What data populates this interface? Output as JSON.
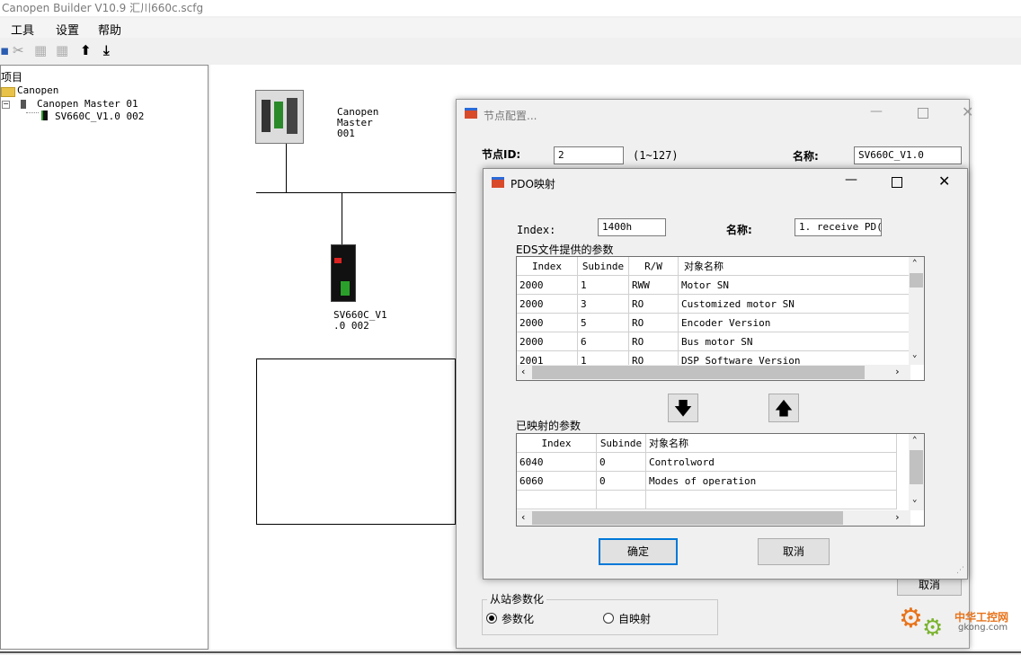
{
  "app": {
    "title": "Canopen Builder V10.9  汇川660c.scfg"
  },
  "menu": {
    "tools": "工具",
    "settings": "设置",
    "help": "帮助"
  },
  "tree": {
    "root": "项目",
    "canopen": "Canopen",
    "master": "Canopen Master  01",
    "slave": "SV660C_V1.0 002"
  },
  "canvas": {
    "master_label_1": "Canopen",
    "master_label_2": "Master",
    "master_label_3": "001",
    "slave_label_1": "SV660C_V1",
    "slave_label_2": ".0   002"
  },
  "node_dialog": {
    "title": "节点配置...",
    "node_id_label": "节点ID:",
    "node_id_value": "2",
    "node_id_range": "(1~127)",
    "name_label": "名称:",
    "name_value": "SV660C_V1.0",
    "cancel_label": "取消",
    "slave_param_group": "从站参数化",
    "radio_param": "参数化",
    "radio_automap": "自映射"
  },
  "pdo_dialog": {
    "title": "PDO映射",
    "index_label": "Index:",
    "index_value": "1400h",
    "name_label": "名称:",
    "name_value": "1. receive PD(",
    "eds_label": "EDS文件提供的参数",
    "eds_headers": [
      "Index",
      "Subinde",
      "R/W",
      "对象名称"
    ],
    "eds_rows": [
      [
        "2000",
        "1",
        "RWW",
        "Motor SN"
      ],
      [
        "2000",
        "3",
        "RO",
        "Customized motor SN"
      ],
      [
        "2000",
        "5",
        "RO",
        "Encoder Version"
      ],
      [
        "2000",
        "6",
        "RO",
        "Bus motor SN"
      ],
      [
        "2001",
        "1",
        "RO",
        "DSP Software Version"
      ]
    ],
    "mapped_label": "已映射的参数",
    "mapped_headers": [
      "Index",
      "Subinde",
      "对象名称"
    ],
    "mapped_rows": [
      [
        "6040",
        "0",
        "Controlword"
      ],
      [
        "6060",
        "0",
        "Modes of operation"
      ]
    ],
    "ok_label": "确定",
    "cancel_label": "取消"
  },
  "watermark": {
    "text_1": "中华工控网",
    "text_2": "gkong.com"
  },
  "colors": {
    "accent": "#0078d7",
    "watermark": "#e8731a"
  }
}
